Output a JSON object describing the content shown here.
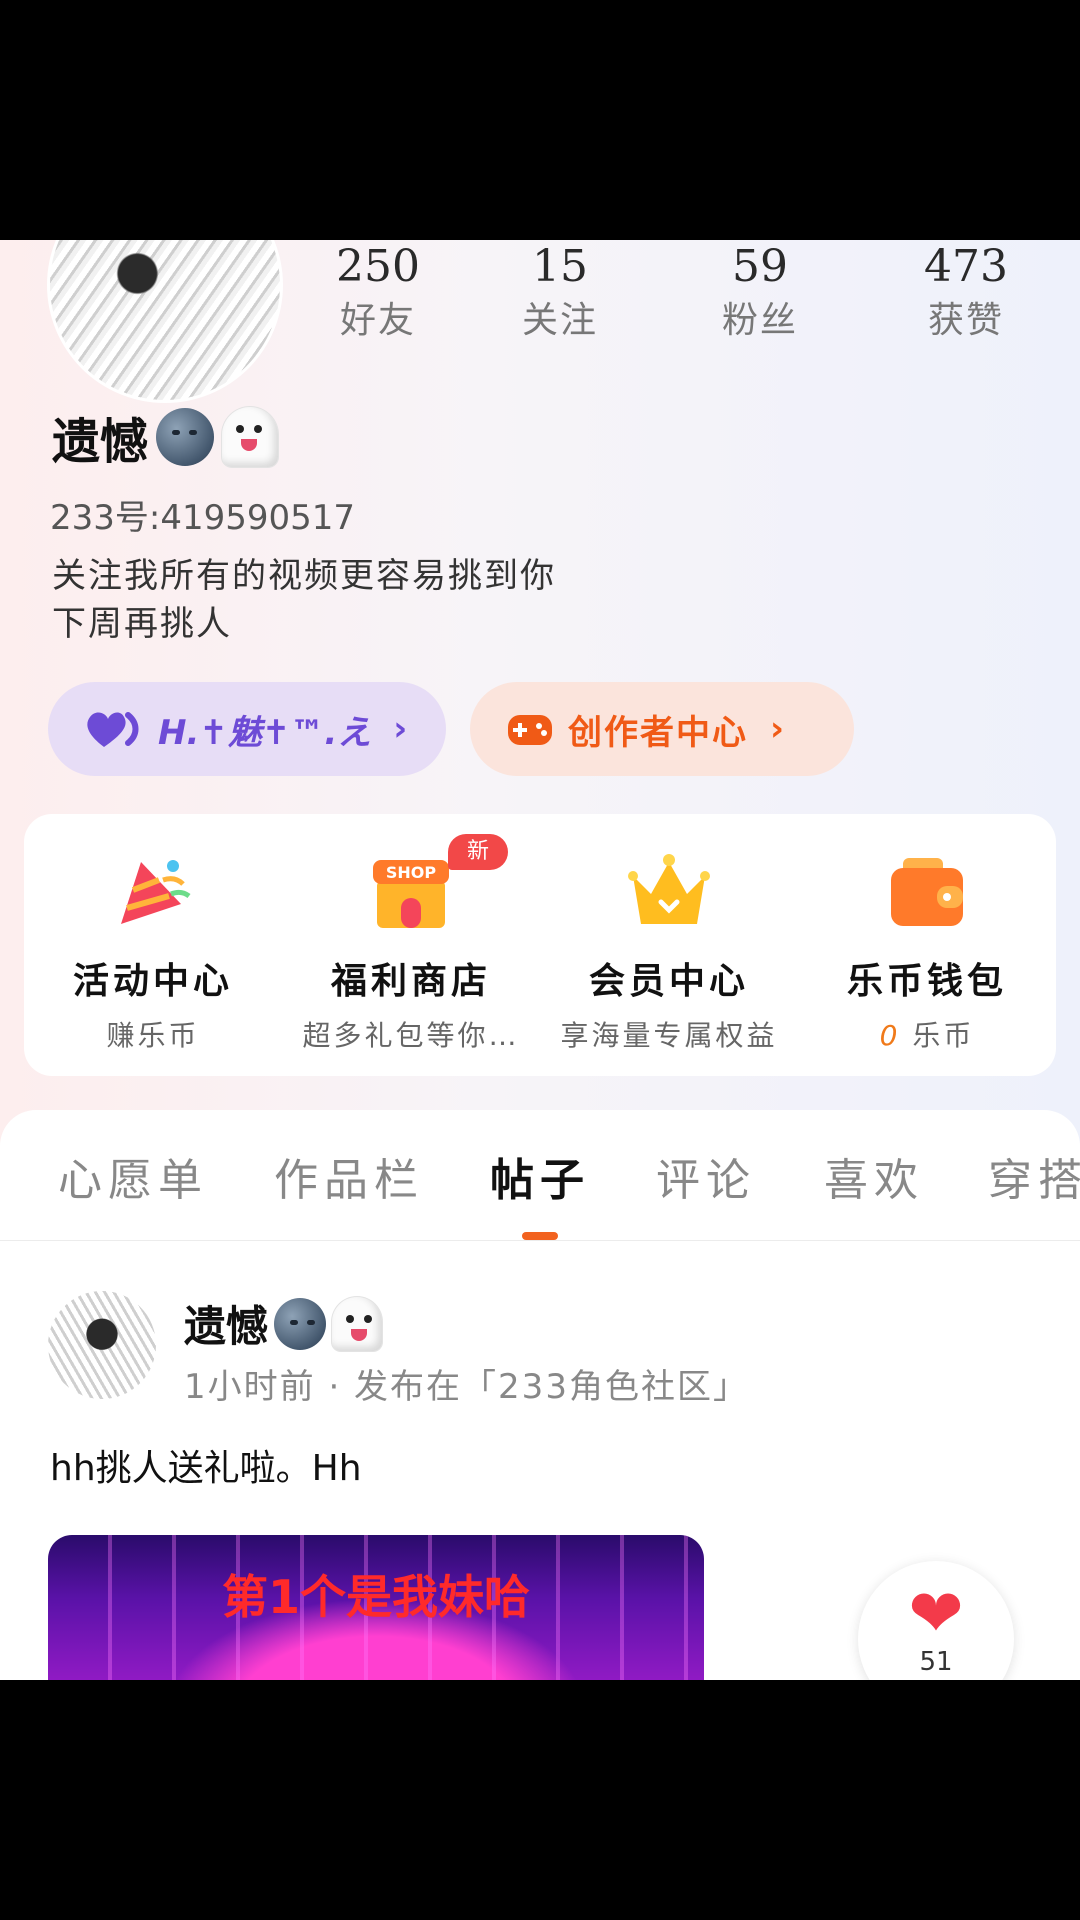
{
  "profile": {
    "nickname": "遗憾",
    "uid": "233号:419590517",
    "bio_line1": "关注我所有的视频更容易挑到你",
    "bio_line2": "下周再挑人",
    "stats": [
      {
        "value": "250",
        "label": "好友"
      },
      {
        "value": "15",
        "label": "关注"
      },
      {
        "value": "59",
        "label": "粉丝"
      },
      {
        "value": "473",
        "label": "获赞"
      }
    ]
  },
  "pills": {
    "family_label": "H.✝魅✝™.え",
    "creator_label": "创作者中心",
    "chevron": "›"
  },
  "quick": {
    "items": [
      {
        "title": "活动中心",
        "sub": "赚乐币"
      },
      {
        "title": "福利商店",
        "sub": "超多礼包等你…",
        "badge": "新",
        "shop_text": "SHOP"
      },
      {
        "title": "会员中心",
        "sub": "享海量专属权益"
      },
      {
        "title": "乐币钱包",
        "sub_value": "0",
        "sub_unit": "乐币"
      }
    ]
  },
  "tabs": [
    "心愿单",
    "作品栏",
    "帖子",
    "评论",
    "喜欢",
    "穿搭"
  ],
  "active_tab": "帖子",
  "post": {
    "author": "遗憾",
    "meta": "1小时前 · 发布在「233角色社区」",
    "text": "hh挑人送礼啦。Hh",
    "image_caption": "第1个是我妹哈",
    "likes": "51"
  },
  "colors": {
    "accent_orange": "#f2621f",
    "purple": "#6d4bd6",
    "like_red": "#f33a4a"
  }
}
